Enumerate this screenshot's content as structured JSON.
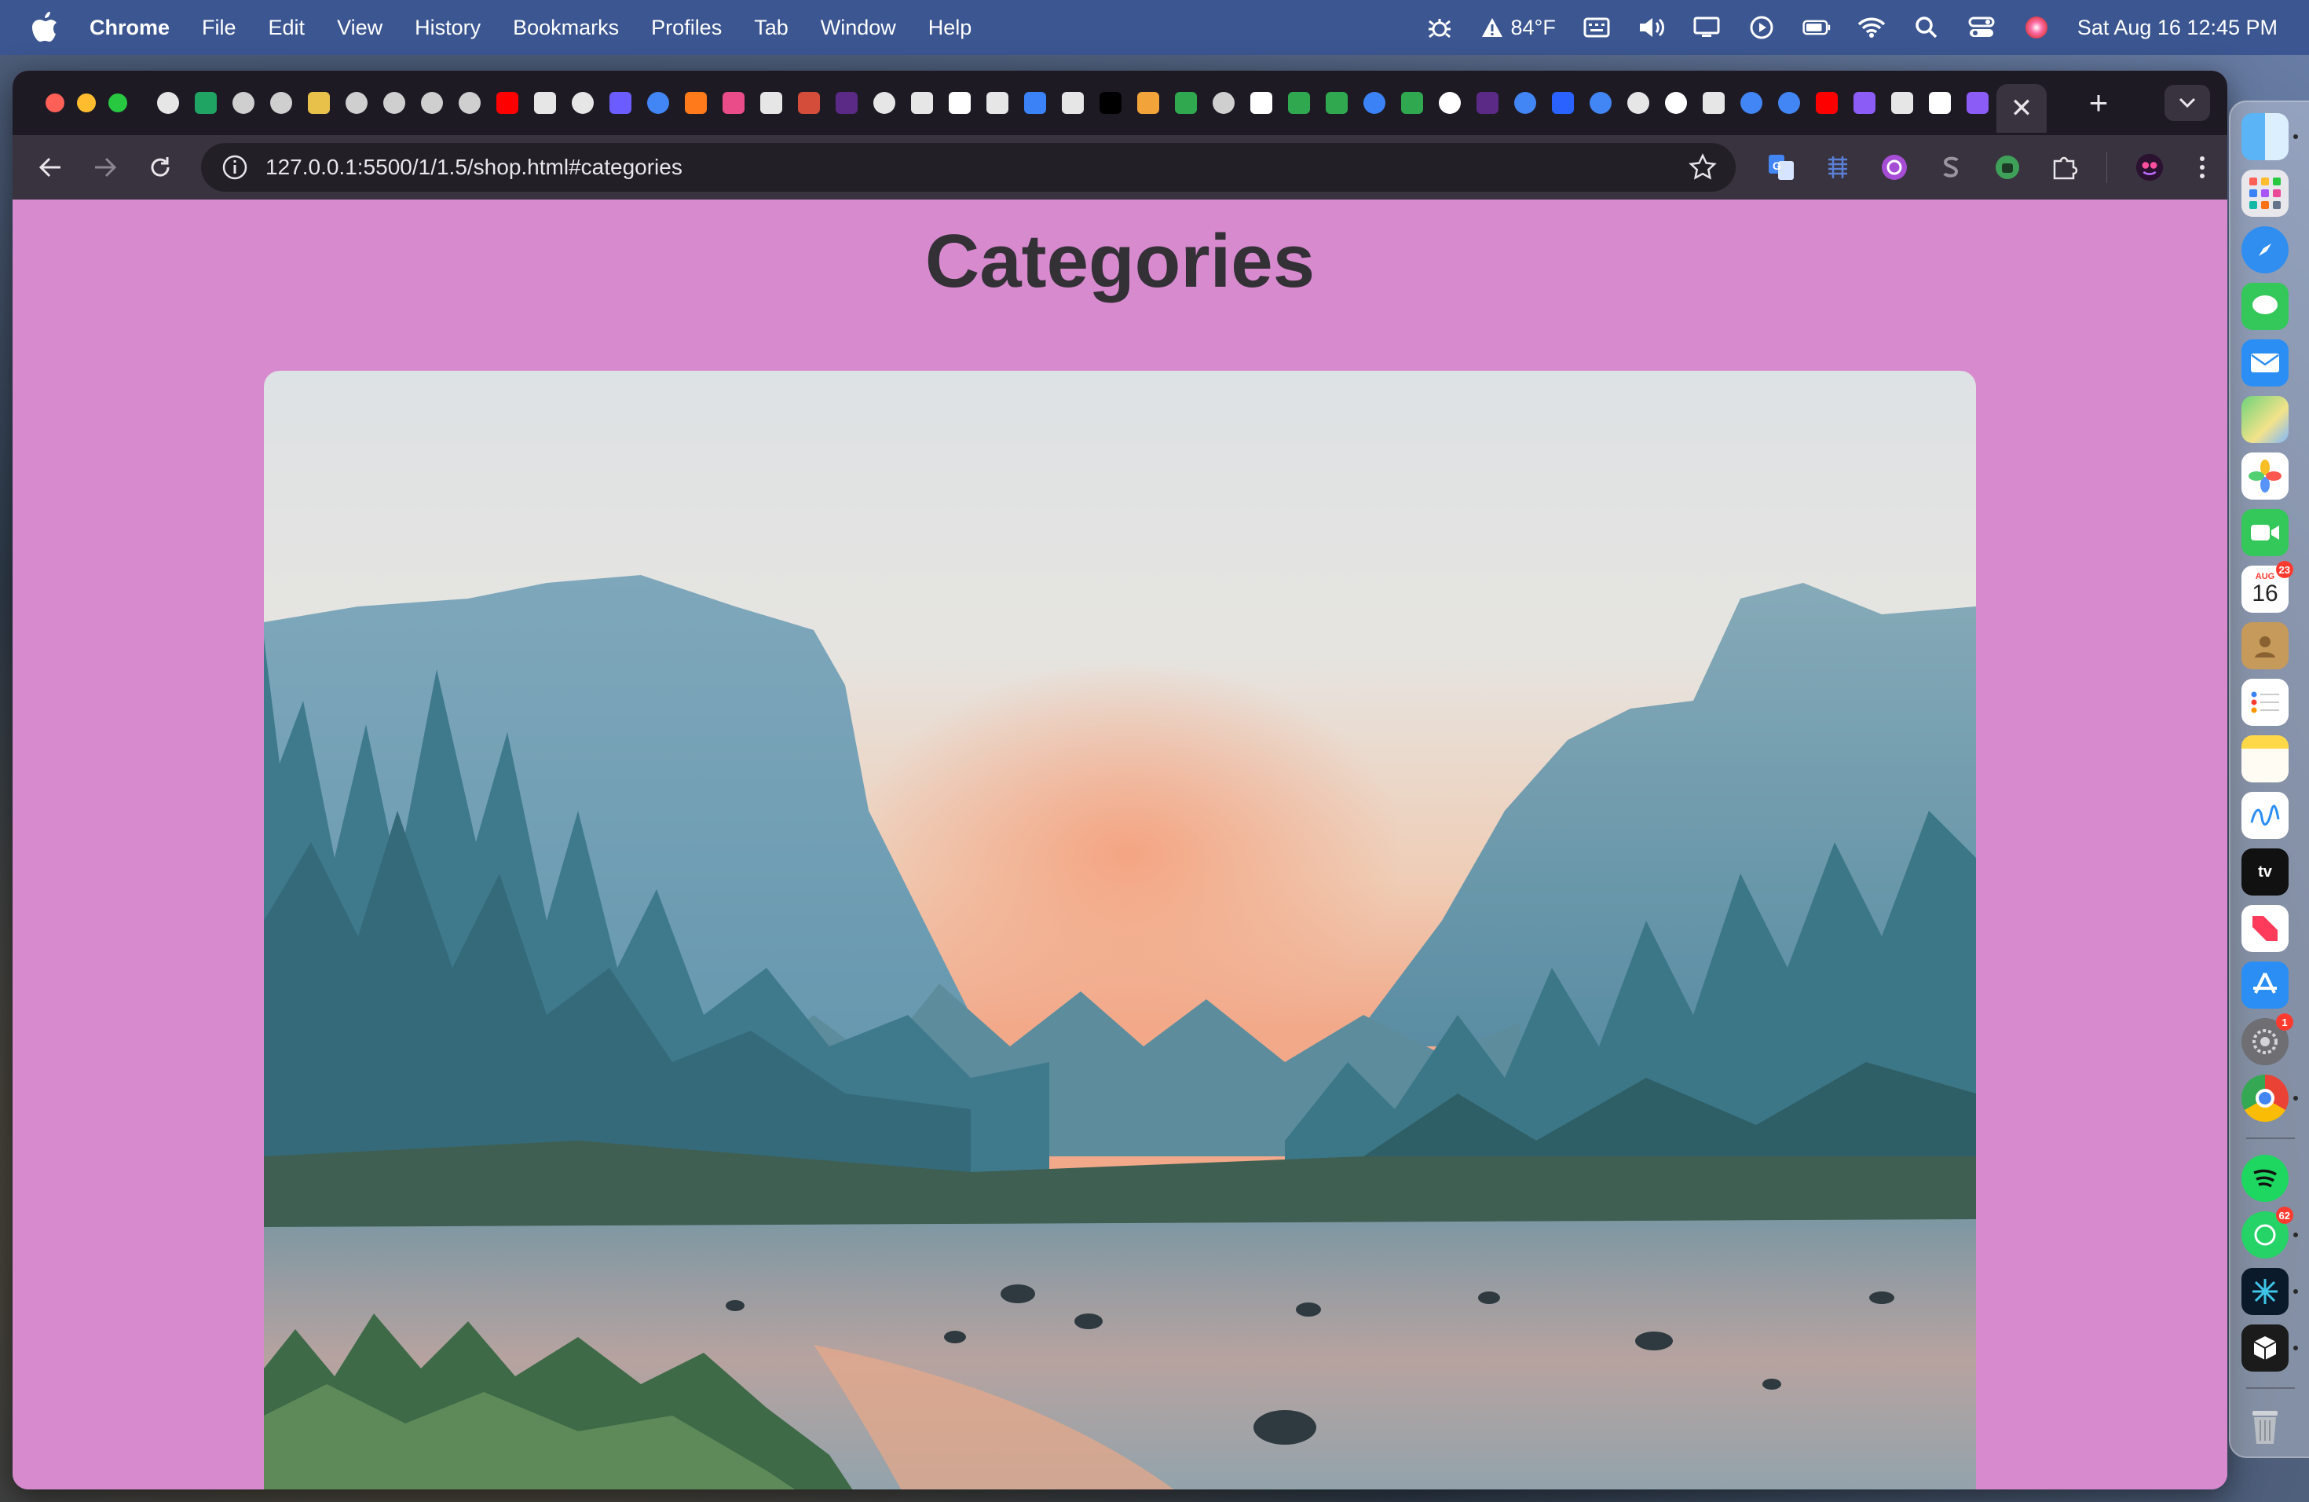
{
  "menubar": {
    "app_name": "Chrome",
    "menus": [
      "File",
      "Edit",
      "View",
      "History",
      "Bookmarks",
      "Profiles",
      "Tab",
      "Window",
      "Help"
    ],
    "weather": "84°F",
    "datetime": "Sat Aug 16  12:45 PM"
  },
  "browser": {
    "url": "127.0.0.1:5500/1/1.5/shop.html#categories",
    "pinned_tab_icons": [
      {
        "name": "chatgpt-icon",
        "color": "#e6e6e6"
      },
      {
        "name": "sheets-icon",
        "color": "#1fa463"
      },
      {
        "name": "globe-icon",
        "color": "#cfcfcf"
      },
      {
        "name": "globe-icon",
        "color": "#cfcfcf"
      },
      {
        "name": "stripes-icon",
        "color": "#e7c14a"
      },
      {
        "name": "globe-icon",
        "color": "#cfcfcf"
      },
      {
        "name": "globe-icon",
        "color": "#cfcfcf"
      },
      {
        "name": "globe-icon",
        "color": "#cfcfcf"
      },
      {
        "name": "globe-icon",
        "color": "#cfcfcf"
      },
      {
        "name": "youtube-icon",
        "color": "#ff0000"
      },
      {
        "name": "wind-icon",
        "color": "#e6e6e6"
      },
      {
        "name": "chatgpt-icon",
        "color": "#e6e6e6"
      },
      {
        "name": "ring-icon",
        "color": "#6b5cff"
      },
      {
        "name": "google-icon",
        "color": "#4285f4"
      },
      {
        "name": "fire-icon",
        "color": "#ff7a1a"
      },
      {
        "name": "dribbble-icon",
        "color": "#ea4c89"
      },
      {
        "name": "puzzle-icon",
        "color": "#e6e6e6"
      },
      {
        "name": "image-icon",
        "color": "#d44c3a"
      },
      {
        "name": "hood-icon",
        "color": "#5b2a86"
      },
      {
        "name": "chatgpt-icon",
        "color": "#e6e6e6"
      },
      {
        "name": "wind-icon",
        "color": "#e6e6e6"
      },
      {
        "name": "box-icon",
        "color": "#ffffff"
      },
      {
        "name": "bug-icon",
        "color": "#e6e6e6"
      },
      {
        "name": "runner-icon",
        "color": "#3b82f6"
      },
      {
        "name": "m-icon",
        "color": "#e6e6e6"
      },
      {
        "name": "dev-icon",
        "color": "#000000"
      },
      {
        "name": "bird-icon",
        "color": "#f2a33a"
      },
      {
        "name": "infinity-icon",
        "color": "#2fa84f"
      },
      {
        "name": "globe-icon",
        "color": "#cfcfcf"
      },
      {
        "name": "layers-icon",
        "color": "#ffffff"
      },
      {
        "name": "w-icon",
        "color": "#2fa84f"
      },
      {
        "name": "w-icon",
        "color": "#2fa84f"
      },
      {
        "name": "circle-icon",
        "color": "#3b82f6"
      },
      {
        "name": "w-icon",
        "color": "#2fa84f"
      },
      {
        "name": "github-icon",
        "color": "#ffffff"
      },
      {
        "name": "hood-icon",
        "color": "#5b2a86"
      },
      {
        "name": "google-icon",
        "color": "#4285f4"
      },
      {
        "name": "hashnode-icon",
        "color": "#2962ff"
      },
      {
        "name": "google-icon",
        "color": "#4285f4"
      },
      {
        "name": "chatgpt-icon",
        "color": "#e6e6e6"
      },
      {
        "name": "github-icon",
        "color": "#ffffff"
      },
      {
        "name": "bug-icon",
        "color": "#e6e6e6"
      },
      {
        "name": "google-icon",
        "color": "#4285f4"
      },
      {
        "name": "google-icon",
        "color": "#4285f4"
      },
      {
        "name": "youtube-icon",
        "color": "#ff0000"
      },
      {
        "name": "loop-icon",
        "color": "#8b5cf6"
      },
      {
        "name": "gear-icon",
        "color": "#e6e6e6"
      },
      {
        "name": "eyes-icon",
        "color": "#ffffff"
      },
      {
        "name": "loop-icon",
        "color": "#8b5cf6"
      }
    ]
  },
  "page": {
    "title": "Categories",
    "hero_alt": "Mountain valley with pine trees and a river at sunset"
  },
  "dock": {
    "calendar_month": "AUG",
    "calendar_day": "16",
    "calendar_badge": "23",
    "settings_badge": "1",
    "whatsapp_badge": "62",
    "tv_label": "tv"
  },
  "colors": {
    "page_background": "#d88acf",
    "title_text": "#333036",
    "menubar": "#3b5691",
    "tabstrip": "#1d1a24",
    "toolbar": "#39333f"
  }
}
